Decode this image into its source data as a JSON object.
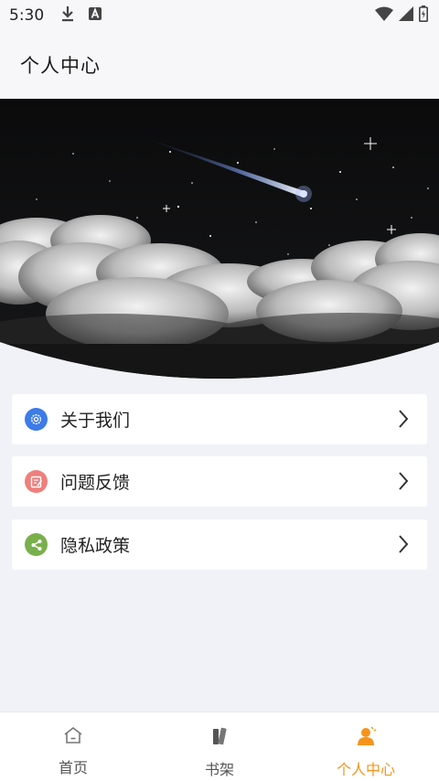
{
  "status_bar": {
    "time": "5:30",
    "left_icons": [
      "download-icon",
      "a-icon"
    ],
    "right_icons": [
      "wifi-icon",
      "signal-icon",
      "battery-icon"
    ]
  },
  "header": {
    "title": "个人中心"
  },
  "banner": {
    "image": "night-sky-shooting-star-clouds"
  },
  "menu": {
    "items": [
      {
        "label": "关于我们",
        "icon": "gear-icon",
        "icon_color": "#3d7be8"
      },
      {
        "label": "问题反馈",
        "icon": "edit-icon",
        "icon_color": "#ee7f7c"
      },
      {
        "label": "隐私政策",
        "icon": "share-icon",
        "icon_color": "#79b04c"
      }
    ]
  },
  "tabbar": {
    "tabs": [
      {
        "label": "首页",
        "icon": "home-icon",
        "active": false
      },
      {
        "label": "书架",
        "icon": "books-icon",
        "active": false
      },
      {
        "label": "个人中心",
        "icon": "person-icon",
        "active": true
      }
    ],
    "active_color": "#f5941c"
  }
}
